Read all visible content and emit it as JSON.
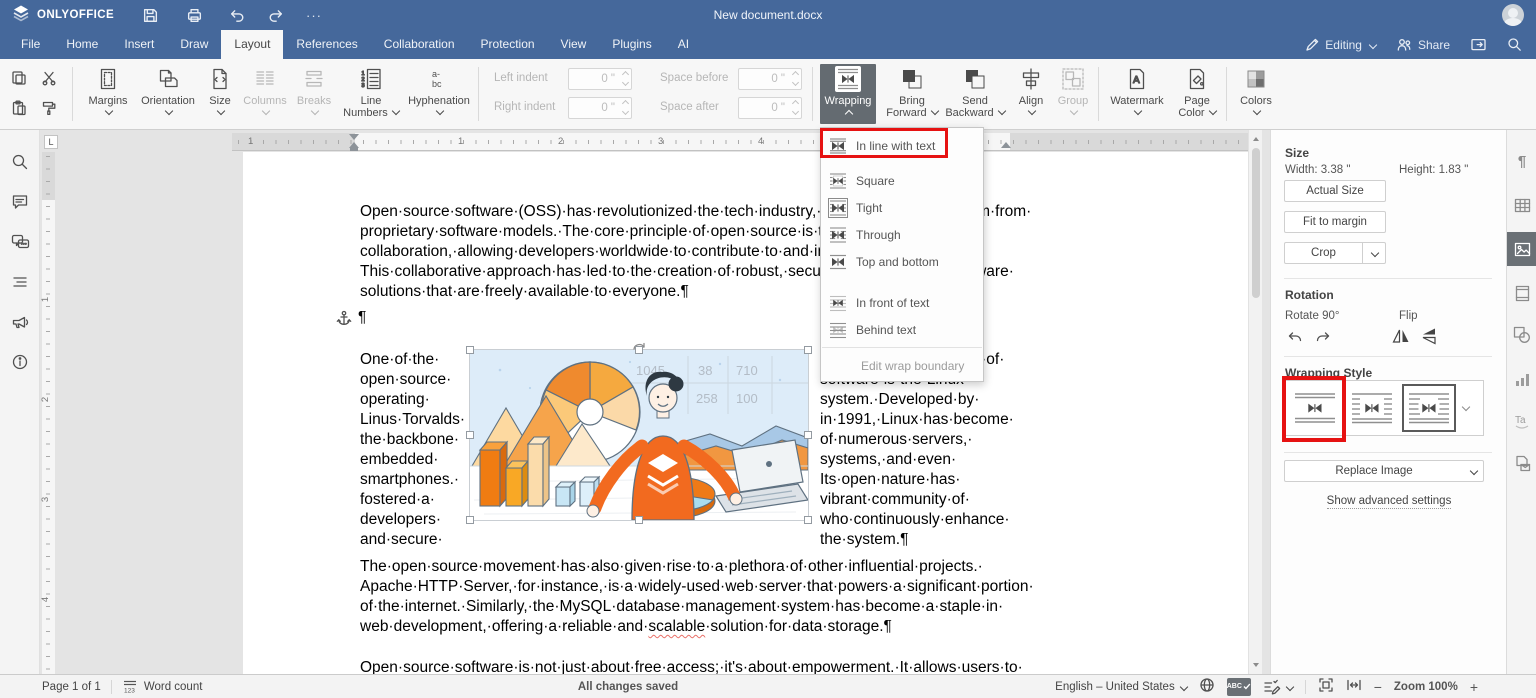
{
  "app": {
    "brand": "ONLYOFFICE",
    "title": "New document.docx",
    "more": "···"
  },
  "menu": {
    "tabs": [
      "File",
      "Home",
      "Insert",
      "Draw",
      "Layout",
      "References",
      "Collaboration",
      "Protection",
      "View",
      "Plugins",
      "AI"
    ],
    "active_tab": "Layout",
    "editing": "Editing",
    "share": "Share"
  },
  "toolbar": {
    "buttons": {
      "margins": "Margins",
      "orientation": "Orientation",
      "size": "Size",
      "columns": "Columns",
      "breaks": "Breaks",
      "line_numbers": "Line Numbers",
      "hyphenation": "Hyphenation",
      "wrapping": "Wrapping",
      "bring_forward": "Bring Forward",
      "send_backward": "Send Backward",
      "align": "Align",
      "group": "Group",
      "watermark": "Watermark",
      "page_color": "Page Color",
      "colors": "Colors"
    },
    "fields": {
      "left_indent": {
        "label": "Left indent",
        "value": "0 \""
      },
      "right_indent": {
        "label": "Right indent",
        "value": "0 \""
      },
      "space_before": {
        "label": "Space before",
        "value": "0 \""
      },
      "space_after": {
        "label": "Space after",
        "value": "0 \""
      }
    }
  },
  "wrap_menu": {
    "items": [
      "In line with text",
      "Square",
      "Tight",
      "Through",
      "Top and bottom",
      "In front of text",
      "Behind text"
    ],
    "selected": "Tight",
    "edit_boundary": "Edit wrap boundary"
  },
  "ruler": {
    "corner": "L",
    "h_numbers": [
      "1",
      "1",
      "2",
      "3",
      "4"
    ],
    "v_numbers": [
      "1",
      "2",
      "3",
      "4"
    ]
  },
  "document": {
    "p1": [
      "Open·source·software·(OSS)·has·revolutionized·the·tech·industry,·offering·a·new·paradigm·from·",
      "proprietary·software·models.·The·core·principle·of·open·source·is·transparency·and·",
      "collaboration,·allowing·developers·worldwide·to·contribute·to·and·improve·existing·code.·",
      "This·collaborative·approach·has·led·to·the·creation·of·robust,·secure,·and·innovative·software·",
      "solutions·that·are·freely·available·to·everyone.¶"
    ],
    "empty_paragraph_mark": "¶",
    "wrap_left": [
      "One·of·the·",
      "open·source·",
      "operating·",
      "Linus·Torvalds·",
      "the·backbone·",
      "embedded·",
      "smartphones.·",
      "fostered·a·",
      "developers·",
      "and·secure·"
    ],
    "wrap_right": [
      "most·notable·examples·of·",
      "software·is·the·Linux·",
      "system.·Developed·by·",
      "in·1991,·Linux·has·become·",
      "of·numerous·servers,·",
      "systems,·and·even·",
      "Its·open·nature·has·",
      "vibrant·community·of·",
      "who·continuously·enhance·",
      "the·system.¶"
    ],
    "p3": [
      "The·open·source·movement·has·also·given·rise·to·a·plethora·of·other·influential·projects.·",
      "Apache·HTTP·Server,·for·instance,·is·a·widely-used·web·server·that·powers·a·significant·portion·",
      "of·the·internet.·Similarly,·the·MySQL·database·management·system·has·become·a·staple·in·"
    ],
    "p3_last": {
      "pre": "web·development,·offering·a·reliable·and·",
      "misspelled": "scalable",
      "post": "·solution·for·data·storage.¶"
    },
    "p4": "Open·source·software·is·not·just·about·free·access;·it's·about·empowerment.·It·allows·users·to·",
    "image_table": {
      "r1c1": "1045",
      "r1c2": "38",
      "r1c3": "710",
      "r2c1": "258",
      "r2c2": "100"
    }
  },
  "right_panel": {
    "size": {
      "title": "Size",
      "width": "Width: 3.38 \"",
      "height": "Height: 1.83 \"",
      "actual_size": "Actual Size",
      "fit_to_margin": "Fit to margin",
      "crop": "Crop"
    },
    "rotation": {
      "title": "Rotation",
      "rotate_label": "Rotate 90°",
      "flip_label": "Flip"
    },
    "wrapping_style": {
      "title": "Wrapping Style"
    },
    "replace_image": "Replace Image",
    "advanced": "Show advanced settings"
  },
  "status_bar": {
    "page": "Page 1 of 1",
    "word_count": "Word count",
    "saved": "All changes saved",
    "language": "English – United States",
    "spell": "ABC",
    "zoom": "Zoom 100%",
    "zoom_out": "−",
    "zoom_in": "+"
  },
  "colors": {
    "header_blue": "#45689b",
    "toolbar_bg": "#f7f7f7",
    "active_button": "#646b71",
    "annotation_red": "#e61212",
    "spellcheck_red": "#e87068",
    "canvas_bg": "#e4e4e4"
  }
}
